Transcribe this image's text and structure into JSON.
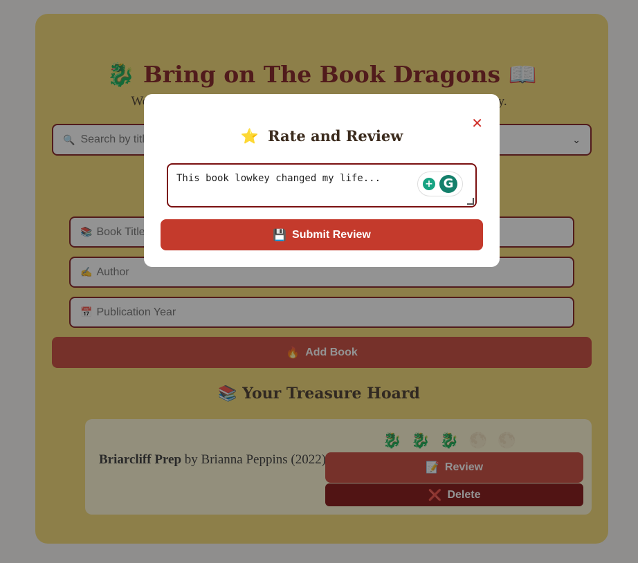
{
  "app": {
    "title": "Bring on The Book Dragons",
    "title_icon_left": "🐉",
    "title_icon_right": "📖",
    "welcome": "Welcome, book dragons! Guard your treasures and review them wisely."
  },
  "search": {
    "icon": "🔍",
    "placeholder": "Search by title",
    "chevron": "⌄"
  },
  "form": {
    "title_icon": "📚",
    "title_placeholder": "Book Title",
    "author_icon": "✍️",
    "author_placeholder": "Author",
    "year_icon": "📅",
    "year_placeholder": "Publication Year",
    "add_icon": "🔥",
    "add_label": "Add Book"
  },
  "hoard": {
    "icon": "📚",
    "title": "Your Treasure Hoard",
    "books": [
      {
        "title": "Briarcliff Prep",
        "by": "by Brianna Peppins",
        "year": "(2022)",
        "rating": 3,
        "rating_max": 5,
        "rating_on_icon": "🐉",
        "rating_off_icon": "🌕",
        "review_icon": "📝",
        "review_label": "Review",
        "delete_icon": "❌",
        "delete_label": "Delete"
      }
    ]
  },
  "modal": {
    "close": "✕",
    "icon": "⭐",
    "title": "Rate and Review",
    "review_text": "This book lowkey changed my life...",
    "submit_icon": "💾",
    "submit_label": "Submit Review"
  },
  "colors": {
    "background": "#f6f5f3",
    "card": "#f3d76a",
    "accent": "#c43a2c",
    "dark_red": "#7a0f10",
    "delete": "#7a0000"
  }
}
